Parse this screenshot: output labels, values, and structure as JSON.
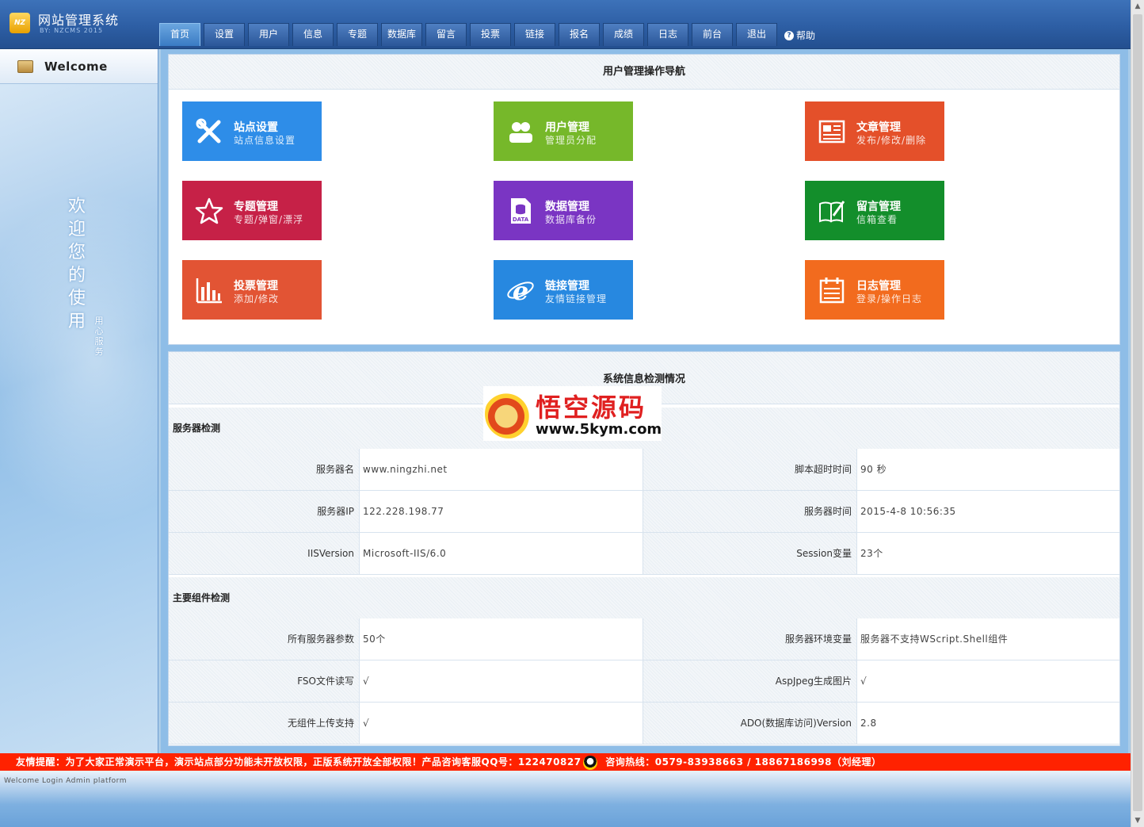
{
  "header": {
    "logo": "NZ",
    "title": "网站管理系统",
    "subtitle": "BY: NZCMS 2015",
    "tabs": [
      "首页",
      "设置",
      "用户",
      "信息",
      "专题",
      "数据库",
      "留言",
      "投票",
      "链接",
      "报名",
      "成绩",
      "日志",
      "前台",
      "退出"
    ],
    "active_tab": "首页",
    "help": "帮助"
  },
  "sidebar": {
    "welcome": "Welcome",
    "vertical_text": "欢迎您的使用",
    "service_text": "用心服务"
  },
  "nav_panel": {
    "title": "用户管理操作导航",
    "tiles": [
      {
        "title": "站点设置",
        "sub": "站点信息设置",
        "color": "#2e8de8",
        "icon": "tools-icon"
      },
      {
        "title": "用户管理",
        "sub": "管理员分配",
        "color": "#76b82a",
        "icon": "users-icon"
      },
      {
        "title": "文章管理",
        "sub": "发布/修改/删除",
        "color": "#e4502a",
        "icon": "article-icon"
      },
      {
        "title": "专题管理",
        "sub": "专题/弹窗/漂浮",
        "color": "#c62147",
        "icon": "star-icon"
      },
      {
        "title": "数据管理",
        "sub": "数据库备份",
        "color": "#7a35c3",
        "icon": "data-icon"
      },
      {
        "title": "留言管理",
        "sub": "信箱查看",
        "color": "#138e2b",
        "icon": "message-icon"
      },
      {
        "title": "投票管理",
        "sub": "添加/修改",
        "color": "#e25434",
        "icon": "chart-icon"
      },
      {
        "title": "链接管理",
        "sub": "友情链接管理",
        "color": "#2788e0",
        "icon": "ie-icon"
      },
      {
        "title": "日志管理",
        "sub": "登录/操作日志",
        "color": "#f26b1e",
        "icon": "calendar-icon"
      }
    ]
  },
  "sys_panel": {
    "title": "系统信息检测情况",
    "server_section": "服务器检测",
    "server_rows": [
      {
        "l1": "服务器名",
        "v1": "www.ningzhi.net",
        "l2": "脚本超时时间",
        "v2": "90 秒"
      },
      {
        "l1": "服务器IP",
        "v1": "122.228.198.77",
        "l2": "服务器时间",
        "v2": "2015-4-8 10:56:35"
      },
      {
        "l1": "IISVersion",
        "v1": "Microsoft-IIS/6.0",
        "l2": "Session变量",
        "v2": "23个"
      }
    ],
    "component_section": "主要组件检测",
    "component_rows": [
      {
        "l1": "所有服务器参数",
        "v1": "50个",
        "l2": "服务器环境变量",
        "v2": "服务器不支持WScript.Shell组件"
      },
      {
        "l1": "FSO文件读写",
        "v1": "√",
        "l2": "AspJpeg生成图片",
        "v2": "√"
      },
      {
        "l1": "无组件上传支持",
        "v1": "√",
        "l2": "ADO(数据库访问)Version",
        "v2": "2.8"
      }
    ]
  },
  "watermark": {
    "text": "悟空源码",
    "url": "www.5kym.com"
  },
  "footer": {
    "notice_1": "友情提醒：为了大家正常演示平台，演示站点部分功能未开放权限，正版系统开放全部权限！产品咨询客服QQ号：122470827",
    "notice_2": "咨询热线：0579-83938663 / 18867186998（刘经理）",
    "status": "Welcome Login Admin platform"
  }
}
